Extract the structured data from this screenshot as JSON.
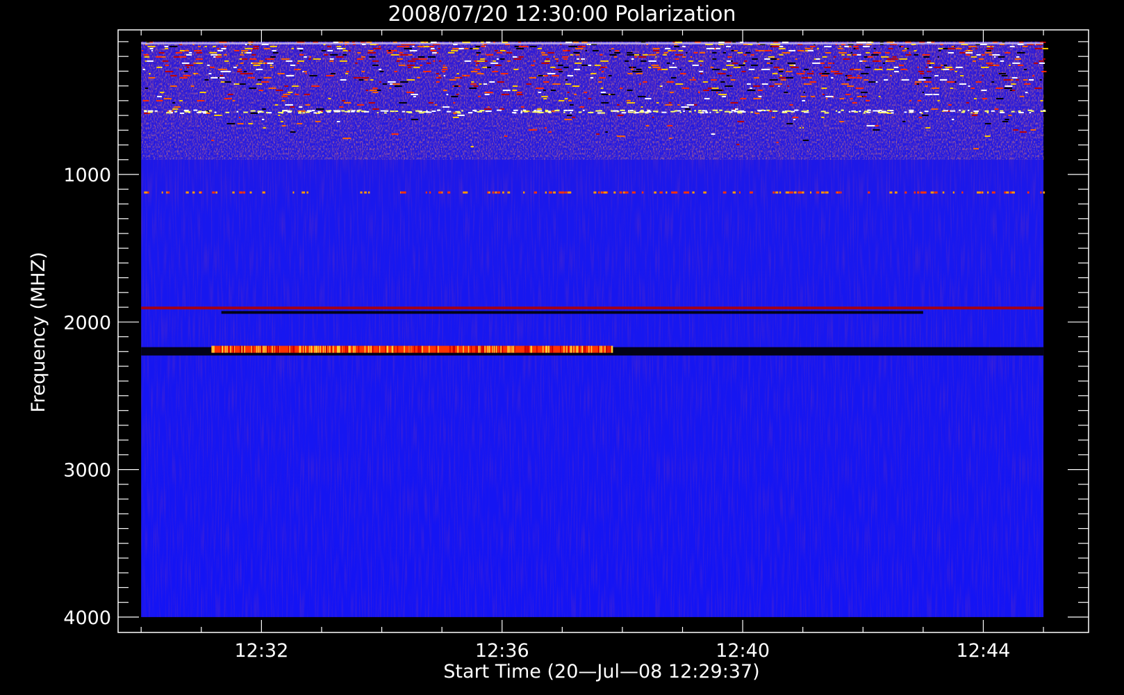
{
  "chart_data": {
    "type": "heatmap",
    "title": "2008/07/20 12:30:00 Polarization",
    "xlabel": "Start Time (20—Jul—08 12:29:37)",
    "ylabel": "Frequency (MHZ)",
    "x_axis": {
      "unit": "minutes",
      "range": [
        "12:29:37",
        "12:45:45"
      ],
      "ticks": [
        {
          "value": "12:32",
          "label": "12:32"
        },
        {
          "value": "12:36",
          "label": "12:36"
        },
        {
          "value": "12:40",
          "label": "12:40"
        },
        {
          "value": "12:44",
          "label": "12:44"
        }
      ]
    },
    "y_axis": {
      "unit": "MHz",
      "range": [
        4100,
        0
      ],
      "inverted": true,
      "ticks": [
        1000,
        2000,
        3000,
        4000
      ]
    },
    "data_extent": {
      "time_start": "12:30:00",
      "time_end": "12:45:00",
      "freq_min": 100,
      "freq_max": 4000
    },
    "colormap": [
      "#000000",
      "#0000ff",
      "#ff0000",
      "#ffff00",
      "#ffffff"
    ],
    "background_color": "#1616f0",
    "features": [
      {
        "kind": "noisy-band",
        "freq": [
          100,
          900
        ]
      },
      {
        "kind": "dotted-line",
        "freq": 1120
      },
      {
        "kind": "line",
        "freq": 1905,
        "color": "#b00000",
        "time": [
          "12:30:00",
          "12:45:00"
        ]
      },
      {
        "kind": "line",
        "freq": 1935,
        "color": "#000000",
        "time": [
          "12:31:20",
          "12:43:00"
        ]
      },
      {
        "kind": "line",
        "freq": 2180,
        "color": "#000000",
        "time": [
          "12:30:00",
          "12:45:00"
        ]
      },
      {
        "kind": "burst",
        "freq": 2185,
        "color": "#ff3300",
        "time": [
          "12:31:10",
          "12:37:50"
        ]
      }
    ]
  }
}
